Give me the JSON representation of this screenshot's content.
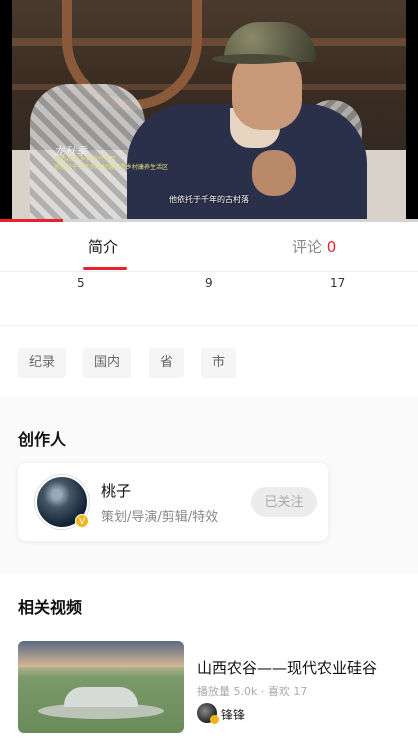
{
  "video": {
    "overlay_name": "龙秋季",
    "overlay_lines": [
      "山西农谷 乡村振兴示范",
      "他依托于千年的古村落打造乡村康养生活区"
    ],
    "subtitle": "他依托于千年的古村落",
    "progress": 0.15
  },
  "tabs": {
    "intro": "简介",
    "comments": "评论",
    "comments_count": "0"
  },
  "stats": [
    "5",
    "9",
    "17"
  ],
  "tags": [
    "纪录",
    "国内",
    "省",
    "市"
  ],
  "creator_section": {
    "title": "创作人",
    "name": "桃子",
    "role": "策划/导演/剪辑/特效",
    "verified_icon": "V",
    "follow_label": "已关注"
  },
  "related_section": {
    "title": "相关视频",
    "items": [
      {
        "title": "山西农谷——现代农业硅谷",
        "meta": "播放量 5.0k · 喜欢 17",
        "author": "锋锋"
      }
    ]
  },
  "colors": {
    "accent": "#e8212f",
    "badge": "#f2b31b"
  }
}
